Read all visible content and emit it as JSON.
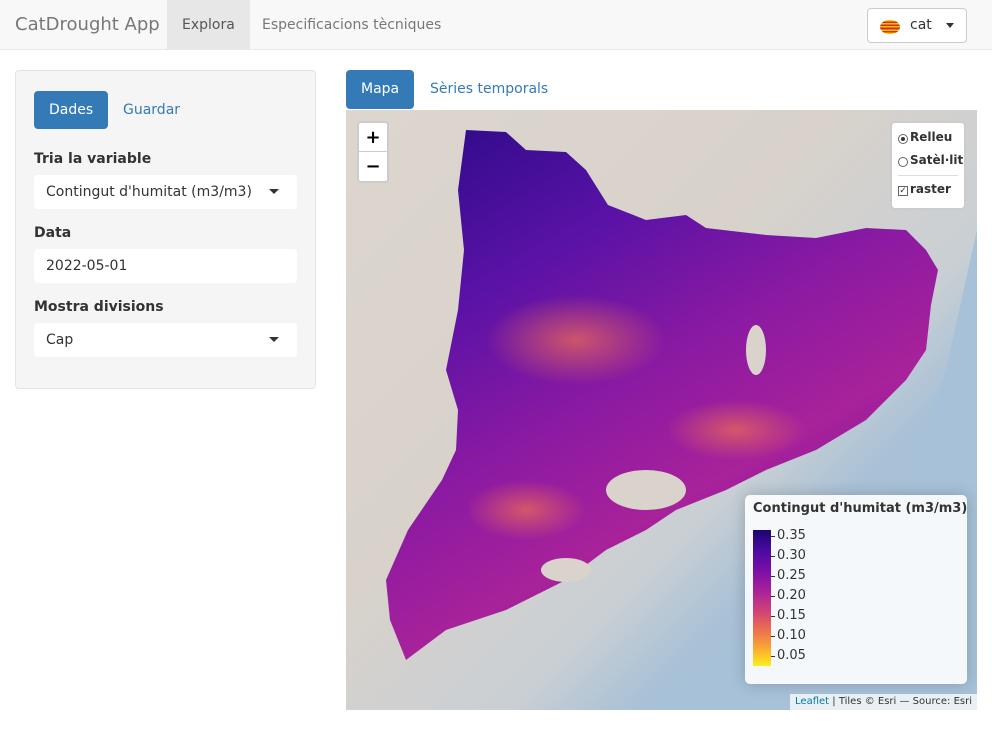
{
  "navbar": {
    "brand": "CatDrought App",
    "tabs": [
      {
        "label": "Explora",
        "active": true
      },
      {
        "label": "Especificacions tècniques",
        "active": false
      }
    ],
    "language": {
      "label": "cat",
      "flag_icon": "catalan-flag-icon"
    }
  },
  "sidebar": {
    "tabs": [
      {
        "label": "Dades",
        "active": true
      },
      {
        "label": "Guardar",
        "active": false
      }
    ],
    "variable": {
      "label": "Tria la variable",
      "value": "Contingut d'humitat (m3/m3)"
    },
    "date": {
      "label": "Data",
      "value": "2022-05-01"
    },
    "divisions": {
      "label": "Mostra divisions",
      "value": "Cap"
    }
  },
  "main_tabs": [
    {
      "label": "Mapa",
      "active": true
    },
    {
      "label": "Sèries temporals",
      "active": false
    }
  ],
  "map": {
    "zoom_in": "+",
    "zoom_out": "−",
    "layers": {
      "base": [
        {
          "label": "Relleu",
          "checked": true
        },
        {
          "label": "Satèl·lit",
          "checked": false
        }
      ],
      "overlays": [
        {
          "label": "raster",
          "checked": true
        }
      ]
    },
    "legend": {
      "title": "Contingut d'humitat (m3/m3)",
      "labels": [
        "0.35",
        "0.30",
        "0.25",
        "0.20",
        "0.15",
        "0.10",
        "0.05"
      ],
      "colors": [
        "#1a0670",
        "#7a0fa8",
        "#cf4474",
        "#f79a38",
        "#f5f020"
      ]
    },
    "attribution": {
      "link": "Leaflet",
      "text": "| Tiles © Esri — Source: Esri"
    }
  }
}
